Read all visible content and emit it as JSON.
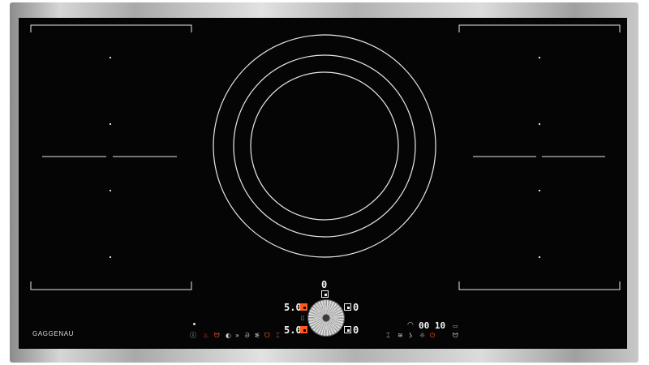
{
  "brand": "GAGGENAU",
  "center_display": {
    "top_level": "0",
    "left_upper_level": "5.0",
    "left_lower_level": "5.0",
    "right_upper_level": "0",
    "right_lower_level": "0"
  },
  "timer": {
    "value": "00 10"
  },
  "controls_left": {
    "icons": [
      "info-icon",
      "pot-icon",
      "steam-pot-icon",
      "frying-pan-icon",
      "chevrons-icon",
      "fry-icon",
      "whisk-icon",
      "warming-pot-icon",
      "grill-bracket-icon"
    ]
  },
  "controls_right": {
    "icons": [
      "timer-icon",
      "flexible-zone-icon",
      "wok-icon",
      "child-lock-icon",
      "power-icon",
      "clean-icon"
    ]
  },
  "colors": {
    "glass": "#050505",
    "line": "#e8e8e8",
    "accent": "#ff5a1f"
  }
}
